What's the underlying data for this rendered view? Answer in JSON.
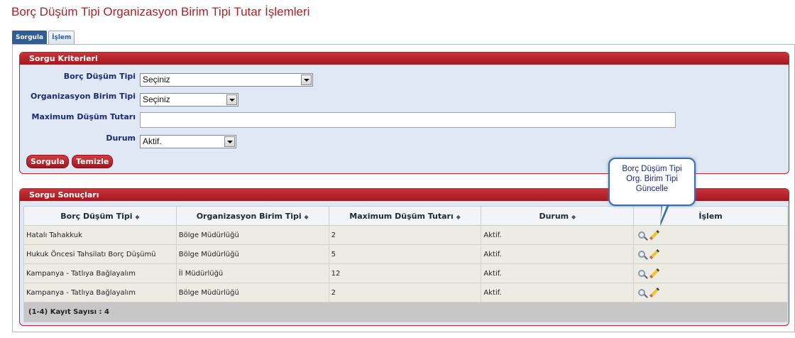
{
  "page": {
    "title": "Borç Düşüm Tipi Organizasyon Birim Tipi Tutar İşlemleri"
  },
  "tabs": [
    {
      "label": "Sorgula",
      "active": true
    },
    {
      "label": "İşlem",
      "active": false
    }
  ],
  "criteria": {
    "header": "Sorgu Kriterleri",
    "fields": {
      "borc_dusum_tipi": {
        "label": "Borç Düşüm Tipi",
        "value": "Seçiniz"
      },
      "organizasyon_birim_tipi": {
        "label": "Organizasyon Birim Tipi",
        "value": "Seçiniz"
      },
      "maximum_dusum_tutari": {
        "label": "Maximum Düşüm Tutarı",
        "value": ""
      },
      "durum": {
        "label": "Durum",
        "value": "Aktif."
      }
    },
    "buttons": {
      "search": "Sorgula",
      "clear": "Temizle"
    }
  },
  "results": {
    "header": "Sorgu Sonuçları",
    "columns": [
      "Borç Düşüm Tipi",
      "Organizasyon Birim Tipi",
      "Maximum Düşüm Tutarı",
      "Durum",
      "İşlem"
    ],
    "sort_icon": "◆",
    "rows": [
      {
        "tip": "Hatalı Tahakkuk",
        "birim": "Bölge Müdürlüğü",
        "tutar": "2",
        "durum": "Aktif."
      },
      {
        "tip": "Hukuk Öncesi Tahsilatı Borç Düşümü",
        "birim": "Bölge Müdürlüğü",
        "tutar": "5",
        "durum": "Aktif."
      },
      {
        "tip": "Kampanya - Tatlıya Bağlayalım",
        "birim": "İl Müdürlüğü",
        "tutar": "12",
        "durum": "Aktif."
      },
      {
        "tip": "Kampanya - Tatlıya Bağlayalım",
        "birim": "Bölge Müdürlüğü",
        "tutar": "2",
        "durum": "Aktif."
      }
    ],
    "footer": "(1-4) Kayıt Sayısı : 4"
  },
  "tooltip": {
    "lines": [
      "Borç Düşüm Tipi",
      "Org. Birim Tipi",
      "Güncelle"
    ]
  },
  "colors": {
    "accent": "#b02027",
    "panel_bg": "#dfe8f4",
    "label": "#1b2a73"
  }
}
